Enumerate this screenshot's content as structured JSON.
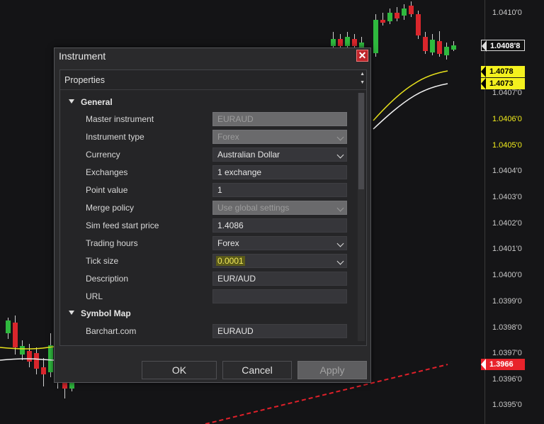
{
  "window": {
    "title": "Instrument",
    "close_glyph": "✕"
  },
  "properties": {
    "header": "Properties",
    "categories": [
      {
        "name": "General"
      },
      {
        "name": "Symbol Map"
      }
    ],
    "general": [
      {
        "label": "Master instrument",
        "value": "EURAUD",
        "kind": "disabled-text"
      },
      {
        "label": "Instrument type",
        "value": "Forex",
        "kind": "disabled-dropdown"
      },
      {
        "label": "Currency",
        "value": "Australian Dollar",
        "kind": "dropdown"
      },
      {
        "label": "Exchanges",
        "value": "1 exchange",
        "kind": "text"
      },
      {
        "label": "Point value",
        "value": "1",
        "kind": "text"
      },
      {
        "label": "Merge policy",
        "value": "Use global settings",
        "kind": "disabled-dropdown"
      },
      {
        "label": "Sim feed start price",
        "value": "1.4086",
        "kind": "text"
      },
      {
        "label": "Trading hours",
        "value": "Forex",
        "kind": "dropdown"
      },
      {
        "label": "Tick size",
        "value": "0.0001",
        "kind": "dropdown",
        "highlighted": true
      },
      {
        "label": "Description",
        "value": "EUR/AUD",
        "kind": "text"
      },
      {
        "label": "URL",
        "value": "",
        "kind": "text"
      }
    ],
    "symbol_map": [
      {
        "label": "Barchart.com",
        "value": "EURAUD",
        "kind": "text"
      }
    ]
  },
  "buttons": {
    "ok": "OK",
    "cancel": "Cancel",
    "apply": "Apply"
  },
  "price_axis": {
    "ticks": [
      "1.0410'0",
      "1.0407'0",
      "1.0406'0",
      "1.0405'0",
      "1.0404'0",
      "1.0403'0",
      "1.0402'0",
      "1.0401'0",
      "1.0400'0",
      "1.0399'0",
      "1.0398'0",
      "1.0397'0",
      "1.0396'0",
      "1.0395'0"
    ],
    "highlighted_ticks": [
      "1.0406'0",
      "1.0405'0"
    ],
    "tags": [
      {
        "text": "1.0408'8",
        "style": "black"
      },
      {
        "text": "1.4078",
        "style": "yellow"
      },
      {
        "text": "1.4073",
        "style": "yellow"
      },
      {
        "text": "1.3966",
        "style": "red"
      }
    ]
  },
  "colors": {
    "up_candle": "#2fb93e",
    "down_candle": "#d9262c",
    "yellow_line": "#e8e21c",
    "white_line": "#f2f2f2",
    "red_dashed": "#e0202a",
    "highlight": "#f1e85a"
  }
}
